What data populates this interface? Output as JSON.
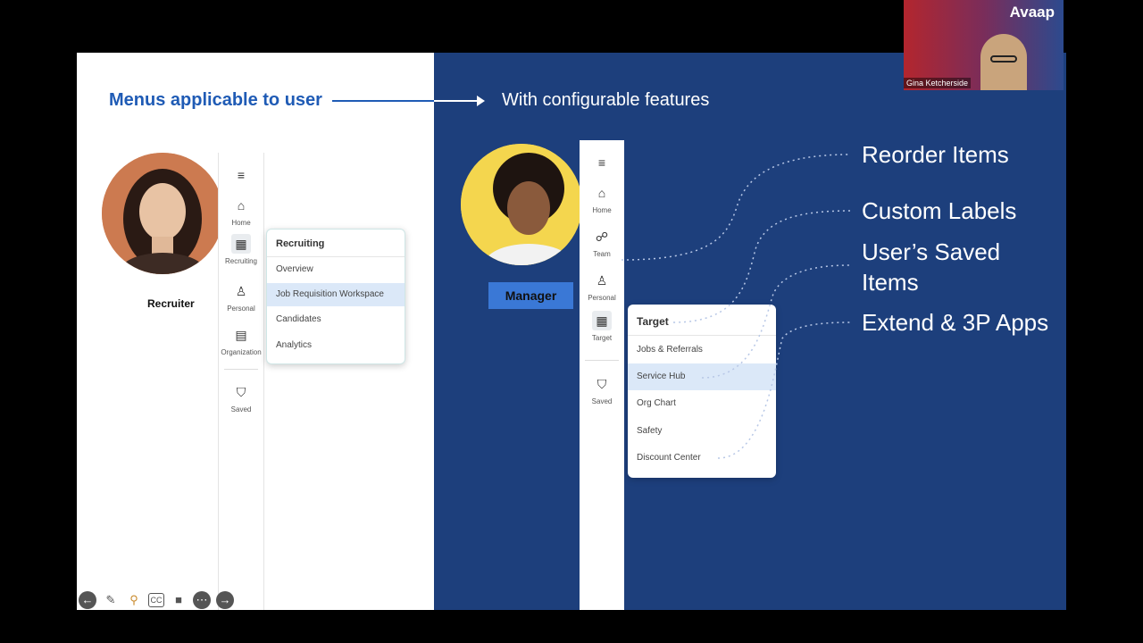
{
  "slide": {
    "left_heading": "Menus applicable to user",
    "right_heading": "With configurable features",
    "recruiter": {
      "label": "Recruiter",
      "nav": [
        "Home",
        "Recruiting",
        "Personal",
        "Organization",
        "Saved"
      ],
      "menu_title": "Recruiting",
      "menu_items": [
        "Overview",
        "Job Requisition Workspace",
        "Candidates",
        "Analytics"
      ]
    },
    "manager": {
      "label": "Manager",
      "nav": [
        "Home",
        "Team",
        "Personal",
        "Target",
        "Saved"
      ],
      "menu_title": "Target",
      "menu_items": [
        "Jobs & Referrals",
        "Service Hub",
        "Org Chart",
        "Safety",
        "Discount Center"
      ]
    },
    "features": [
      "Reorder Items",
      "Custom Labels",
      "User’s Saved Items",
      "Extend & 3P Apps"
    ]
  },
  "video_tile": {
    "brand": "Avaap",
    "name": "Gina Ketcherside"
  },
  "colors": {
    "accent_blue": "#1f5bb5",
    "panel_blue": "#1d3f7c",
    "highlight": "#dbe8f8"
  },
  "toolbar_icons": [
    "back-icon",
    "pen-icon",
    "search-icon",
    "cc-icon",
    "camera-icon",
    "more-icon",
    "forward-icon"
  ]
}
